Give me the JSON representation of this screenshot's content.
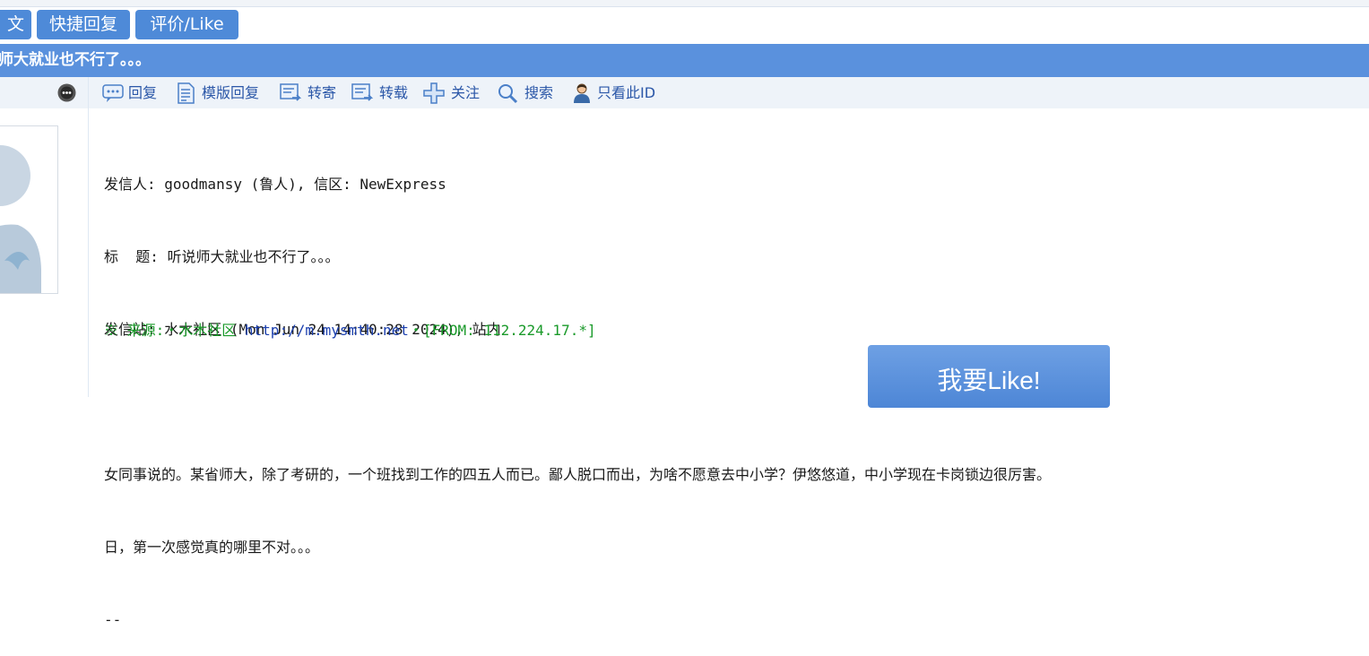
{
  "top_buttons": {
    "reply_post_partial": "文",
    "quick_reply": "快捷回复",
    "rate_like": "评价/Like"
  },
  "thread_title": "师大就业也不行了。。。",
  "actions": {
    "reply": "回复",
    "template_reply": "模版回复",
    "forward": "转寄",
    "repost": "转载",
    "follow": "关注",
    "search": "搜索",
    "only_this_id": "只看此ID"
  },
  "post": {
    "header_from": "发信人: goodmansy (鲁人), 信区: NewExpress",
    "header_title": "标  题: 听说师大就业也不行了。。。",
    "header_station": "发信站: 水木社区 (Mon Jun 24 14:40:28 2024), 站内",
    "body_line1": "女同事说的。某省师大，除了考研的，一个班找到工作的四五人而已。鄙人脱口而出，为啥不愿意去中小学？伊悠悠道，中小学现在卡岗锁边很厉害。",
    "body_line2": "日，第一次感觉真的哪里不对。。。",
    "signature_sep": "--",
    "source_prefix": "※ 来源:・水木社区 ",
    "source_link": "http://m.mysmth.net",
    "source_suffix": "・[FROM: 112.224.17.*]"
  },
  "like_button": "我要Like!",
  "colors": {
    "button_blue": "#4e8ad8",
    "title_bar": "#5a91dd",
    "action_bar_bg": "#eef3f9",
    "link_blue": "#2b57a8",
    "source_green": "#1a9a2a"
  },
  "icons": [
    "user-info-icon",
    "reply-icon",
    "template-reply-icon",
    "forward-icon",
    "repost-icon",
    "follow-plus-icon",
    "search-icon",
    "user-filter-icon"
  ]
}
